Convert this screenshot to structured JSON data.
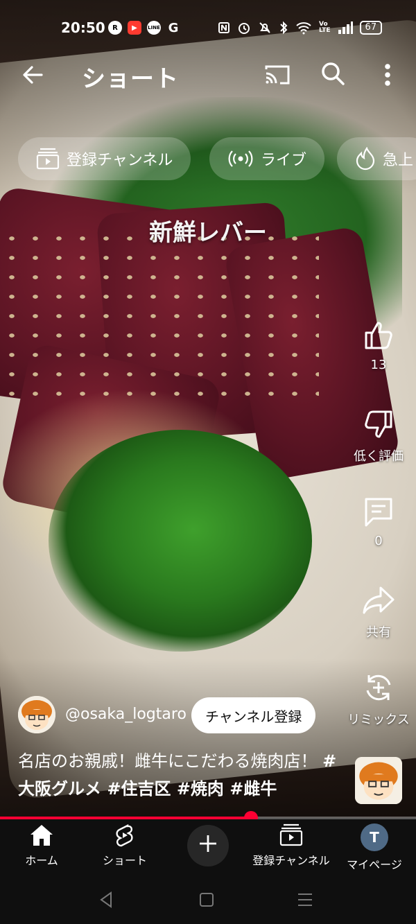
{
  "status_bar": {
    "time": "20:50",
    "app_badges": [
      "R",
      "▶",
      "LINE",
      "G"
    ],
    "volte": "Vo\nLTE",
    "battery": "67"
  },
  "app_bar": {
    "title": "ショート"
  },
  "chips": [
    {
      "label": "登録チャンネル",
      "icon": "subscriptions-icon"
    },
    {
      "label": "ライブ",
      "icon": "live-icon"
    },
    {
      "label": "急上",
      "icon": "trending-icon"
    }
  ],
  "video": {
    "overlay_title": "新鮮レバー",
    "progress": 0.603
  },
  "actions": {
    "like_count": "13",
    "dislike_label": "低く評価",
    "comment_count": "0",
    "share_label": "共有",
    "remix_label": "リミックス"
  },
  "channel": {
    "handle": "@osaka_logtaro",
    "subscribe_label": "チャンネル登録"
  },
  "description": {
    "text": "名店のお親戚！雌牛にこだわる焼肉店！",
    "hashtags": "#大阪グルメ #住吉区 #焼肉 #雌牛"
  },
  "bottom_nav": {
    "home": "ホーム",
    "shorts": "ショート",
    "subscriptions": "登録チャンネル",
    "me": "マイページ",
    "me_initial": "T"
  },
  "colors": {
    "accent": "#ff0033",
    "nav_bg": "#0f0f0f"
  }
}
